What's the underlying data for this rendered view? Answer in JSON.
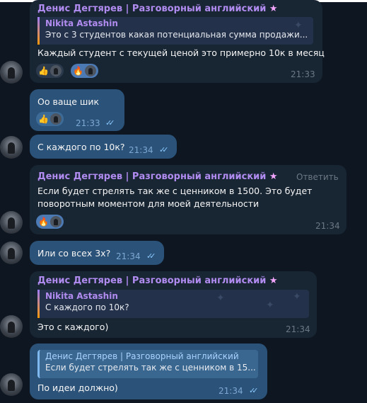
{
  "messages": [
    {
      "sender": "Денис Дегтярев | Разговорный английский",
      "star": "★",
      "quote": {
        "name": "Nikita Astashin",
        "text": "Это с 3 студентов какая потенциальная сумма продажи..."
      },
      "text": "Каждый студент с текущей ценой это примерно 10к в месяц",
      "time": "21:33",
      "reactions": [
        "👍",
        "🔥"
      ]
    },
    {
      "text": "Оо ваще шик",
      "time": "21:33",
      "reactions": [
        "👍"
      ]
    },
    {
      "text": "С каждого по 10к?",
      "time": "21:34"
    },
    {
      "sender": "Денис Дегтярев | Разговорный английский",
      "star": "★",
      "reply_action": "Ответить",
      "text_lines": [
        "Если будет стрелять так же с ценником в 1500. Это будет",
        "поворотным моментом для моей деятельности"
      ],
      "time": "21:34",
      "reactions": [
        "🔥"
      ]
    },
    {
      "text": "Или со всех 3х?",
      "time": "21:34"
    },
    {
      "sender": "Денис Дегтярев | Разговорный английский",
      "star": "★",
      "quote": {
        "name": "Nikita Astashin",
        "text": "С каждого по 10к?"
      },
      "text": "Это с каждого)",
      "time": "21:34"
    },
    {
      "quote": {
        "name": "Денис Дегтярев | Разговорный английский",
        "text": "Если будет стрелять так же с ценником в 15..."
      },
      "text": "По идеи должно)",
      "time": "21:34"
    }
  ],
  "colors": {
    "background": "#0e1621",
    "incoming": "#182533",
    "outgoing": "#2b5278",
    "sender": "#b18cf0"
  }
}
